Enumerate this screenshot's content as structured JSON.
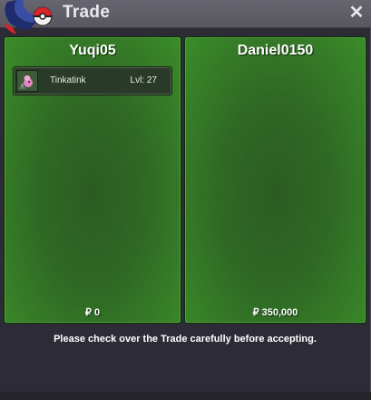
{
  "window": {
    "title": "Trade",
    "close_icon": "close-icon"
  },
  "left_panel": {
    "name": "Yuqi05",
    "items": [
      {
        "name": "Tinkatink",
        "level": "Lvl: 27",
        "icon": "tinkatink-sprite-icon"
      }
    ],
    "money": "₽ 0"
  },
  "right_panel": {
    "name": "Daniel0150",
    "items": [],
    "money": "₽ 350,000"
  },
  "footer": {
    "message": "Please check over the Trade carefully before accepting."
  },
  "colors": {
    "panel_green": "#2f6a24",
    "panel_border": "#4fa13a",
    "window_bg": "#2d2c36",
    "titlebar": "#605f68"
  }
}
